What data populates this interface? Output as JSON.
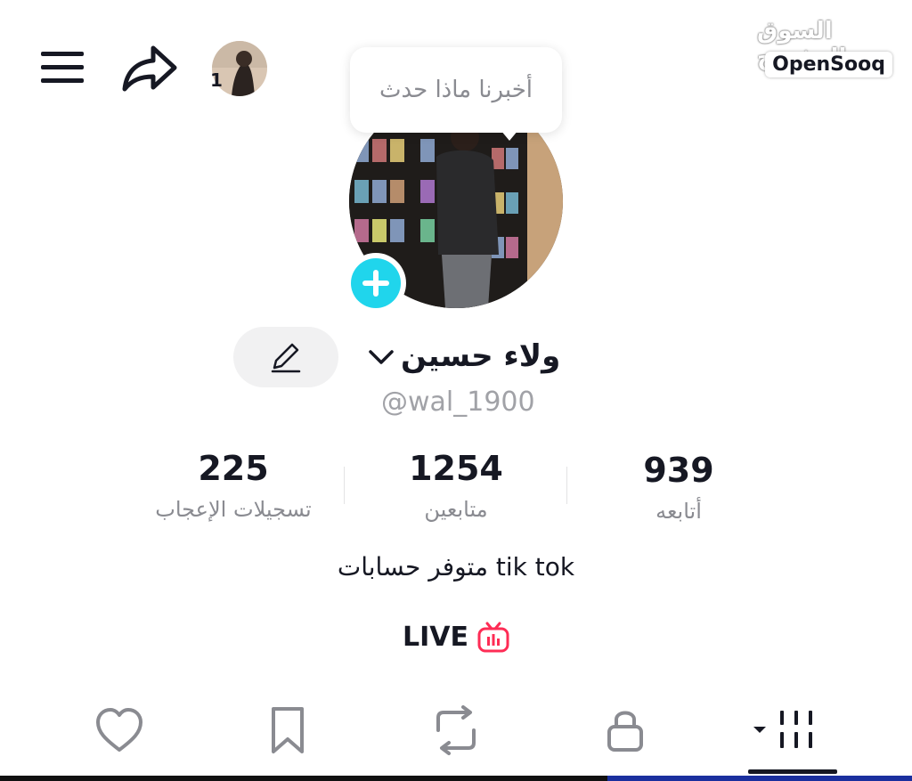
{
  "header": {
    "friends_count": "1",
    "watermark_ar": "السوق المفتوح",
    "watermark_en": "OpenSooq"
  },
  "bubble": {
    "text": "أخبرنا ماذا حدث"
  },
  "profile": {
    "display_name": "ولاء حسين",
    "username": "@wal_1900",
    "bio": "متوفر حسابات tik tok",
    "live_label": "LIVE"
  },
  "stats": [
    {
      "value": "939",
      "label": "أتابعه"
    },
    {
      "value": "1254",
      "label": "متابعين"
    },
    {
      "value": "225",
      "label": "تسجيلات الإعجاب"
    }
  ],
  "tabs": [
    {
      "icon": "videos-grid-icon",
      "active": true
    },
    {
      "icon": "lock-icon",
      "active": false
    },
    {
      "icon": "repost-icon",
      "active": false
    },
    {
      "icon": "bookmark-icon",
      "active": false
    },
    {
      "icon": "heart-icon",
      "active": false
    }
  ],
  "colors": {
    "accent": "#20d5ec",
    "live_icon": "#fe2c55",
    "text": "#161823",
    "muted": "#8a8b91"
  }
}
